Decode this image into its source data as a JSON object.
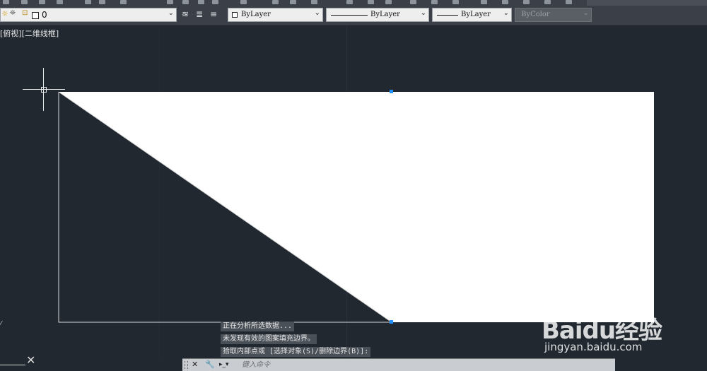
{
  "toolbar": {
    "layer_name": "0",
    "color": "ByLayer",
    "linetype": "ByLayer",
    "lineweight": "ByLayer",
    "plotstyle": "ByColor"
  },
  "viewport": {
    "label": "[俯视][二维线框]"
  },
  "command_history": [
    "正在分析所选数据...",
    "未发现有效的图案填充边界。",
    "拾取内部点或 [选择对象(S)/删除边界(B)]:"
  ],
  "command_line": {
    "placeholder": "键入命令"
  },
  "watermark": {
    "logo": "Baidu经验",
    "url": "jingyan.baidu.com"
  },
  "colors": {
    "background": "#212830",
    "grip": "#1e90ff",
    "fill": "#ffffff",
    "line": "#d9d9d9"
  }
}
